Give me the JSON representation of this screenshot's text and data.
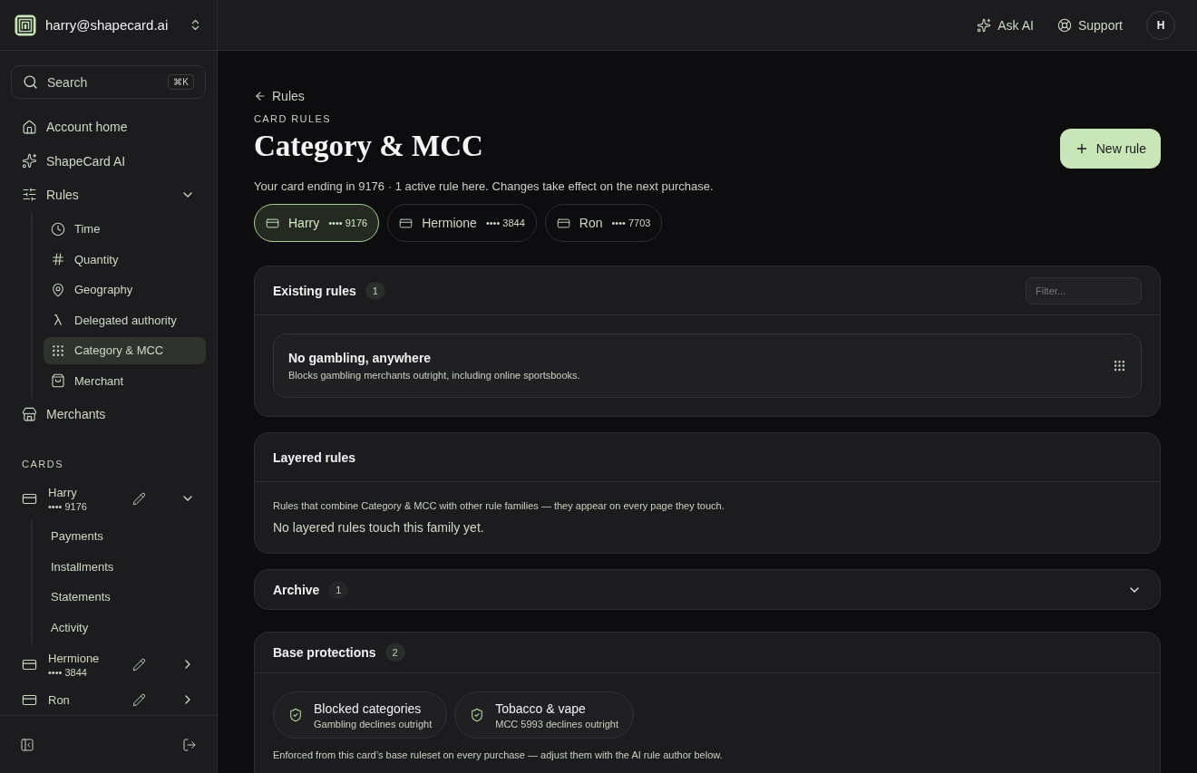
{
  "account": {
    "email": "harry@shapecard.ai"
  },
  "search": {
    "placeholder": "Search",
    "shortcut": "⌘K"
  },
  "nav": [
    {
      "label": "Account home",
      "kind": "home",
      "selected": false
    },
    {
      "label": "ShapeCard AI",
      "kind": "sparkles",
      "selected": false
    },
    {
      "label": "Rules",
      "kind": "sliders",
      "selected": false,
      "expanded": true,
      "children": [
        {
          "label": "Time",
          "kind": "clock",
          "selected": false
        },
        {
          "label": "Quantity",
          "kind": "hash",
          "selected": false
        },
        {
          "label": "Geography",
          "kind": "pin",
          "selected": false
        },
        {
          "label": "Delegated authority",
          "kind": "lambda",
          "selected": false
        },
        {
          "label": "Category & MCC",
          "kind": "grid",
          "selected": true
        },
        {
          "label": "Merchant",
          "kind": "bag",
          "selected": false
        }
      ]
    },
    {
      "label": "Merchants",
      "kind": "store",
      "selected": false
    }
  ],
  "cards_section": {
    "title": "CARDS",
    "cards": [
      {
        "name": "Harry",
        "number": "•••• 9176",
        "expanded": true,
        "children": [
          {
            "label": "Payments"
          },
          {
            "label": "Installments"
          },
          {
            "label": "Statements"
          },
          {
            "label": "Activity"
          }
        ]
      },
      {
        "name": "Hermione",
        "number": "•••• 3844",
        "expanded": false
      },
      {
        "name": "Ron",
        "expanded": false
      }
    ]
  },
  "header": {
    "ask_ai": "Ask AI",
    "support": "Support",
    "avatar": "H"
  },
  "page": {
    "back": "Rules",
    "eyebrow": "CARD RULES",
    "title": "Category & MCC",
    "subtitle": "Your card ending in 9176 · 1 active rule here. Changes take effect on the next purchase.",
    "new_rule": "New rule",
    "card_tabs": [
      {
        "name": "Harry",
        "number": "•••• 9176",
        "selected": true
      },
      {
        "name": "Hermione",
        "number": "•••• 3844",
        "selected": false
      },
      {
        "name": "Ron",
        "number": "•••• 7703",
        "selected": false
      }
    ]
  },
  "existing_rules": {
    "title": "Existing rules",
    "count": "1",
    "filter_placeholder": "Filter...",
    "rules": [
      {
        "title": "No gambling, anywhere",
        "description": "Blocks gambling merchants outright, including online sportsbooks."
      }
    ]
  },
  "layered_rules": {
    "title": "Layered rules",
    "description": "Rules that combine Category & MCC with other rule families — they appear on every page they touch.",
    "empty": "No layered rules touch this family yet."
  },
  "archive": {
    "title": "Archive",
    "count": "1",
    "expanded": false
  },
  "base_protections": {
    "title": "Base protections",
    "count": "2",
    "items": [
      {
        "title": "Blocked categories",
        "description": "Gambling declines outright"
      },
      {
        "title": "Tobacco & vape",
        "description": "MCC 5993 declines outright"
      }
    ],
    "note": "Enforced from this card’s base ruleset on every purchase — adjust them with the AI rule author below."
  }
}
